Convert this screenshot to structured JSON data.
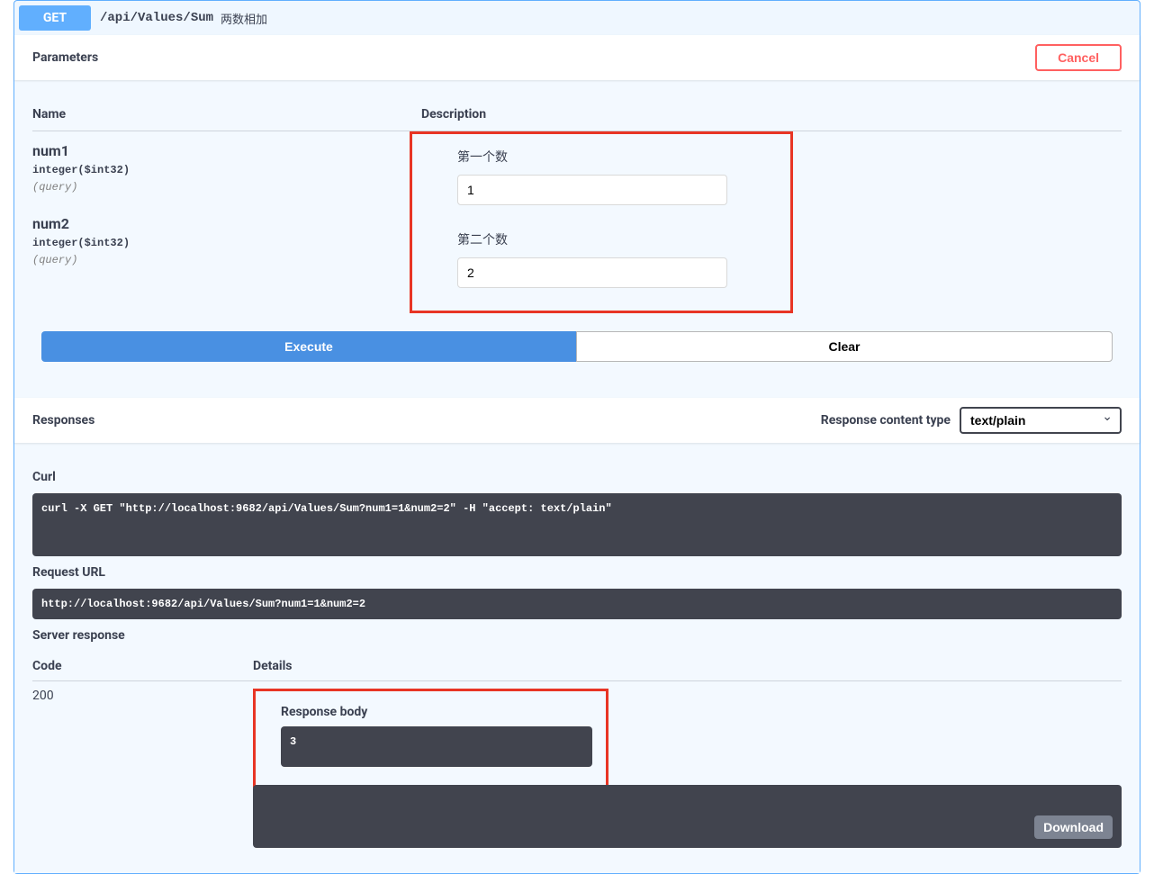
{
  "operation": {
    "method": "GET",
    "path": "/api/Values/Sum",
    "summary": "两数相加"
  },
  "sections": {
    "parameters_title": "Parameters",
    "cancel_label": "Cancel",
    "name_header": "Name",
    "description_header": "Description",
    "execute_label": "Execute",
    "clear_label": "Clear",
    "responses_title": "Responses",
    "content_type_label": "Response content type",
    "content_type_value": "text/plain",
    "curl_title": "Curl",
    "request_url_title": "Request URL",
    "server_response_title": "Server response",
    "code_header": "Code",
    "details_header": "Details",
    "response_body_title": "Response body",
    "download_label": "Download"
  },
  "parameters": [
    {
      "name": "num1",
      "type": "integer($int32)",
      "in": "(query)",
      "description": "第一个数",
      "value": "1"
    },
    {
      "name": "num2",
      "type": "integer($int32)",
      "in": "(query)",
      "description": "第二个数",
      "value": "2"
    }
  ],
  "response": {
    "curl": "curl -X GET \"http://localhost:9682/api/Values/Sum?num1=1&num2=2\" -H \"accept: text/plain\"",
    "request_url": "http://localhost:9682/api/Values/Sum?num1=1&num2=2",
    "code": "200",
    "body": "3"
  }
}
